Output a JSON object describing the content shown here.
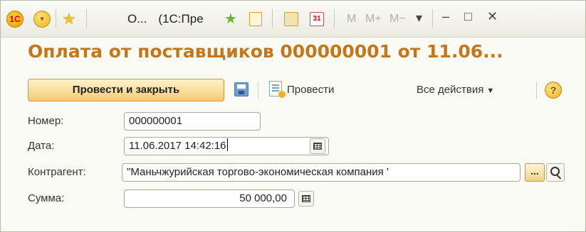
{
  "window": {
    "title_short": "О...",
    "title_app": "(1С:Пре",
    "memory_buttons": [
      "M",
      "M+",
      "M−"
    ],
    "controls": {
      "dropdown": "▾",
      "minimize": "–",
      "maximize": "□",
      "close": "✕"
    }
  },
  "document": {
    "title": "Оплата от поставщиков 000000001 от 11.06..."
  },
  "commands": {
    "post_and_close": "Провести и закрыть",
    "post": "Провести",
    "all_actions": "Все действия",
    "help": "?"
  },
  "form": {
    "number_label": "Номер:",
    "number_value": "000000001",
    "date_label": "Дата:",
    "date_value": "11.06.2017 14:42:16",
    "contractor_label": "Контрагент:",
    "contractor_value": "\"Маньчжурийская торгово-экономическая компания '",
    "contractor_select_button": "...",
    "sum_label": "Сумма:",
    "sum_value": "50 000,00"
  },
  "icons": {
    "app_logo": "1c-logo-icon",
    "main_menu": "main-menu-icon",
    "favorites": "favorites-star-icon",
    "save": "save-icon",
    "post": "post-document-icon",
    "calendar": "calendar-icon",
    "calculator": "calculator-icon",
    "search": "search-icon"
  },
  "colors": {
    "title": "#c4761a",
    "primary_button": "#f3cc74",
    "window_bg": "#fbfbf6"
  }
}
